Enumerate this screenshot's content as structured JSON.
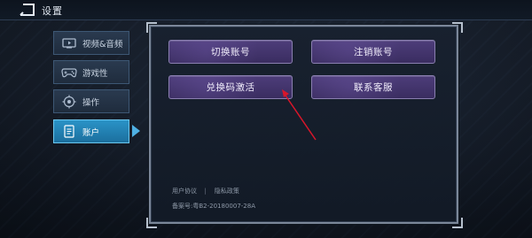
{
  "header": {
    "title": "设置",
    "back_icon": "back-arrow-icon"
  },
  "sidebar": {
    "items": [
      {
        "label": "视频&音频",
        "icon": "video-icon",
        "active": false
      },
      {
        "label": "游戏性",
        "icon": "gamepad-icon",
        "active": false
      },
      {
        "label": "操作",
        "icon": "target-icon",
        "active": false
      },
      {
        "label": "账户",
        "icon": "account-document-icon",
        "active": true
      }
    ]
  },
  "panel": {
    "buttons": {
      "switch_account": "切换账号",
      "cancel_account": "注销账号",
      "redeem_code": "兑换码激活",
      "contact_service": "联系客服"
    },
    "footer": {
      "user_agreement": "用户协议",
      "separator": "|",
      "privacy_policy": "隐私政策",
      "registration": "备案号:粤B2-20180007-28A"
    }
  },
  "colors": {
    "active_tab": "#2a93c7",
    "button_fill": "#4d3d7a",
    "annotation_arrow": "#d8162a"
  }
}
